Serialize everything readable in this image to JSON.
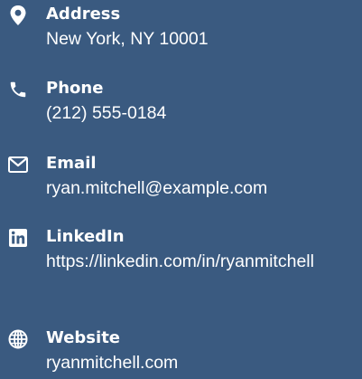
{
  "contacts": [
    {
      "icon": "location-pin-icon",
      "label": "Address",
      "value": "New York, NY 10001"
    },
    {
      "icon": "phone-icon",
      "label": "Phone",
      "value": "(212) 555-0184"
    },
    {
      "icon": "envelope-icon",
      "label": "Email",
      "value": "ryan.mitchell@example.com"
    },
    {
      "icon": "linkedin-icon",
      "label": "LinkedIn",
      "value": "https://linkedin.com/in/ryanmitchell"
    },
    {
      "icon": "globe-icon",
      "label": "Website",
      "value": "ryanmitchell.com"
    }
  ],
  "colors": {
    "background": "#3a5a80",
    "text": "#ffffff"
  }
}
